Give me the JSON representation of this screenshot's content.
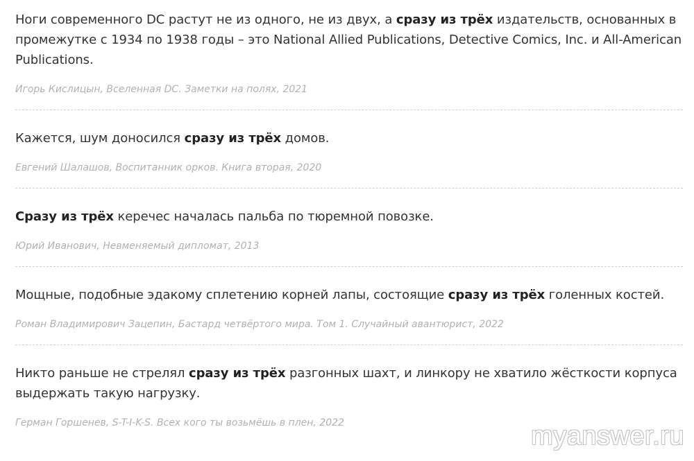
{
  "entries": [
    {
      "before": "Ноги современного DC растут не из одного, не из двух, а ",
      "highlight": "сразу из трёх",
      "after": " издательств, основанных в промежутке с 1934 по 1938 годы – это National Allied Publications, Detective Comics, Inc. и All-American Publications.",
      "source": "Игорь Кислицын, Вселенная DC. Заметки на полях, 2021"
    },
    {
      "before": "Кажется, шум доносился ",
      "highlight": "сразу из трёх",
      "after": " домов.",
      "source": "Евгений Шалашов, Воспитанник орков. Книга вторая, 2020"
    },
    {
      "before": "",
      "highlight": "Сразу из трёх",
      "after": " керечес началась пальба по тюремной повозке.",
      "source": "Юрий Иванович, Невменяемый дипломат, 2013"
    },
    {
      "before": "Мощные, подобные эдакому сплетению корней лапы, состоящие ",
      "highlight": "сразу из трёх",
      "after": " голенных костей.",
      "source": "Роман Владимирович Зацепин, Бастард четвёртого мира. Том 1. Случайный авантюрист, 2022"
    },
    {
      "before": "Никто раньше не стрелял ",
      "highlight": "сразу из трёх",
      "after": " разгонных шахт, и линкору не хватило жёсткости корпуса выдержать такую нагрузку.",
      "source": "Герман Горшенев, S-T-I-K-S. Всех кого ты возьмёшь в плен, 2022"
    }
  ],
  "watermark": "myanswer.ru"
}
